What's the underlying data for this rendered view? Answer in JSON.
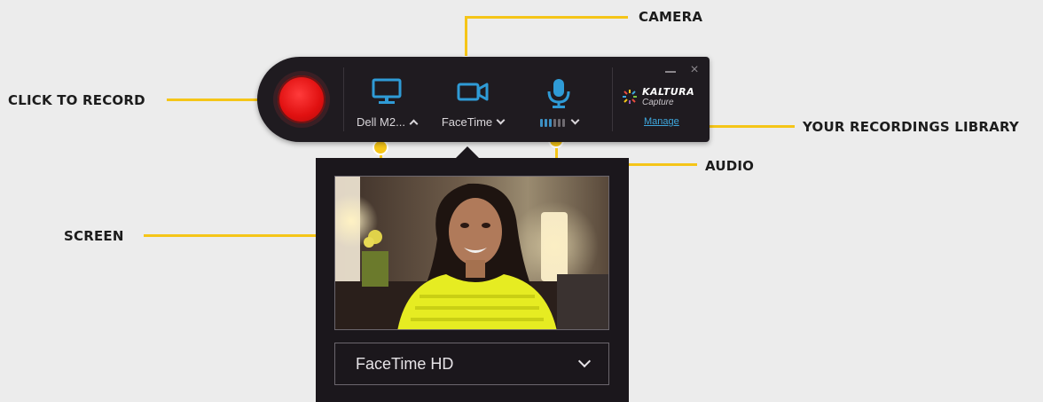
{
  "callouts": {
    "camera": "CAMERA",
    "click_to_record": "CLICK TO RECORD",
    "your_recordings_library": "YOUR RECORDINGS LIBRARY",
    "audio": "AUDIO",
    "screen": "SCREEN"
  },
  "toolbar": {
    "record_button": "record-icon",
    "screen": {
      "icon": "monitor-icon",
      "label": "Dell M2...",
      "chevron": "chevron-up-icon"
    },
    "camera": {
      "icon": "video-camera-icon",
      "label": "FaceTime",
      "chevron": "chevron-down-icon"
    },
    "audio": {
      "icon": "microphone-icon",
      "level_bars_active": 3,
      "level_bars_total": 6,
      "chevron": "chevron-down-icon"
    },
    "window_controls": {
      "minimize": "minimize-icon",
      "close": "×"
    },
    "brand": {
      "name": "KALTURA",
      "sub": "Capture"
    },
    "manage_link": "Manage"
  },
  "camera_panel": {
    "preview": "webcam-preview",
    "selected_camera": "FaceTime HD",
    "dropdown_icon": "chevron-down-icon"
  },
  "colors": {
    "callout_yellow": "#f5c518",
    "toolbar_bg": "#1f1b20",
    "accent_blue": "#2f9bd6",
    "record_red": "#e01010",
    "link_blue": "#3ea7dd"
  }
}
